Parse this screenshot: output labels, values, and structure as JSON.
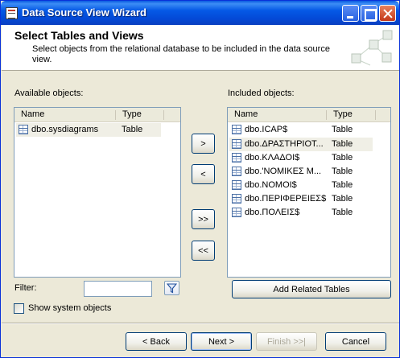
{
  "window": {
    "title": "Data Source View Wizard"
  },
  "header": {
    "title": "Select Tables and Views",
    "description": "Select objects from the relational database to be included in the data source view."
  },
  "available": {
    "label": "Available objects:",
    "columns": {
      "name": "Name",
      "type": "Type"
    },
    "rows": [
      {
        "name": "dbo.sysdiagrams",
        "type": "Table"
      }
    ]
  },
  "included": {
    "label": "Included objects:",
    "columns": {
      "name": "Name",
      "type": "Type"
    },
    "rows": [
      {
        "name": "dbo.ICAP$",
        "type": "Table"
      },
      {
        "name": "dbo.ΔΡΑΣΤΗΡΙΟΤ...",
        "type": "Table"
      },
      {
        "name": "dbo.ΚΛΑΔΟΙ$",
        "type": "Table"
      },
      {
        "name": "dbo.'ΝΟΜΙΚΕΣ Μ...",
        "type": "Table"
      },
      {
        "name": "dbo.ΝΟΜΟΙ$",
        "type": "Table"
      },
      {
        "name": "dbo.ΠΕΡΙΦΕΡΕΙΕΣ$",
        "type": "Table"
      },
      {
        "name": "dbo.ΠΟΛΕΙΣ$",
        "type": "Table"
      }
    ]
  },
  "transfer": {
    "add": ">",
    "remove": "<",
    "add_all": ">>",
    "remove_all": "<<"
  },
  "filter": {
    "label": "Filter:",
    "value": ""
  },
  "show_system": {
    "label": "Show system objects",
    "checked": false
  },
  "add_related_label": "Add Related Tables",
  "nav": {
    "back": "< Back",
    "next": "Next >",
    "finish": "Finish >>|",
    "cancel": "Cancel"
  }
}
